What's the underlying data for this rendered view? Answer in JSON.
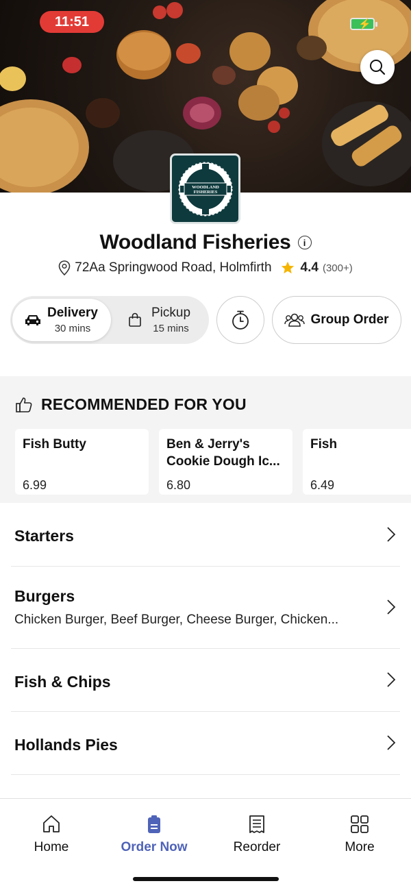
{
  "status_bar": {
    "time": "11:51"
  },
  "restaurant": {
    "name": "Woodland Fisheries",
    "logo_text_line1": "WOODLAND",
    "logo_text_line2": "FISHERIES",
    "address": "72Aa Springwood Road, Holmfirth",
    "rating": "4.4",
    "rating_count": "(300+)"
  },
  "order_mode": {
    "delivery_label": "Delivery",
    "delivery_time": "30 mins",
    "pickup_label": "Pickup",
    "pickup_time": "15 mins",
    "group_order_label": "Group Order"
  },
  "recommended": {
    "heading": "RECOMMENDED FOR YOU",
    "items": [
      {
        "name": "Fish Butty",
        "price": "6.99"
      },
      {
        "name": "Ben & Jerry's Cookie Dough Ic...",
        "price": "6.80"
      },
      {
        "name": "Fish",
        "price": "6.49"
      }
    ]
  },
  "categories": [
    {
      "title": "Starters",
      "subtitle": ""
    },
    {
      "title": "Burgers",
      "subtitle": "Chicken Burger, Beef Burger, Cheese Burger, Chicken..."
    },
    {
      "title": "Fish & Chips",
      "subtitle": ""
    },
    {
      "title": "Hollands Pies",
      "subtitle": ""
    }
  ],
  "tabs": [
    {
      "label": "Home",
      "icon": "home-icon"
    },
    {
      "label": "Order Now",
      "icon": "order-icon"
    },
    {
      "label": "Reorder",
      "icon": "receipt-icon"
    },
    {
      "label": "More",
      "icon": "grid-icon"
    }
  ],
  "colors": {
    "accent": "#4f63b8",
    "logo_bg": "#0e3a3d",
    "star": "#f5b400",
    "time_pill": "#e23b36"
  }
}
